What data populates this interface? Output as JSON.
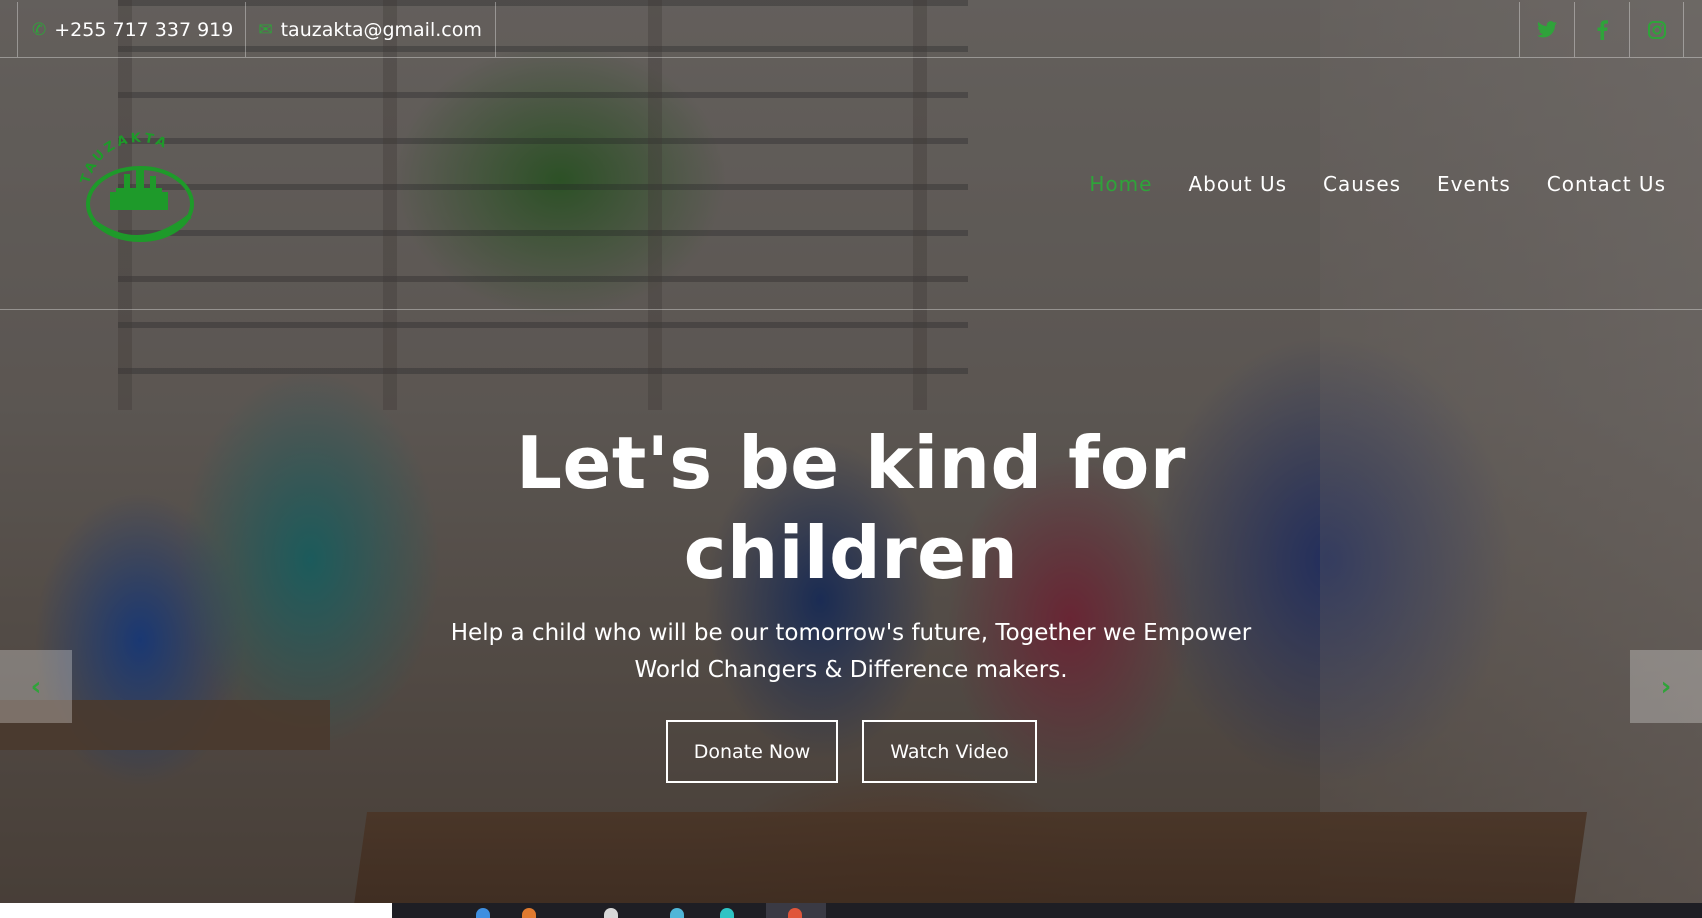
{
  "topbar": {
    "phone": "+255 717 337 919",
    "email": "tauzakta@gmail.com",
    "social": [
      {
        "name": "twitter-icon",
        "glyph": "🐦"
      },
      {
        "name": "facebook-icon",
        "glyph": "f"
      },
      {
        "name": "instagram-icon",
        "glyph": "◎"
      }
    ]
  },
  "logo": {
    "text": "TAUZAKTA"
  },
  "nav": {
    "items": [
      {
        "label": "Home",
        "active": true
      },
      {
        "label": "About Us",
        "active": false
      },
      {
        "label": "Causes",
        "active": false
      },
      {
        "label": "Events",
        "active": false
      },
      {
        "label": "Contact Us",
        "active": false
      }
    ]
  },
  "hero": {
    "title_line1": "Let's be kind for",
    "title_line2": "children",
    "subtitle_line1": "Help a child who will be our tomorrow's future, Together we Empower",
    "subtitle_line2": "World Changers & Difference makers.",
    "donate_label": "Donate Now",
    "watch_label": "Watch Video",
    "prev_glyph": "‹",
    "next_glyph": "›"
  },
  "colors": {
    "accent": "#2fa33a",
    "text": "#ffffff"
  }
}
